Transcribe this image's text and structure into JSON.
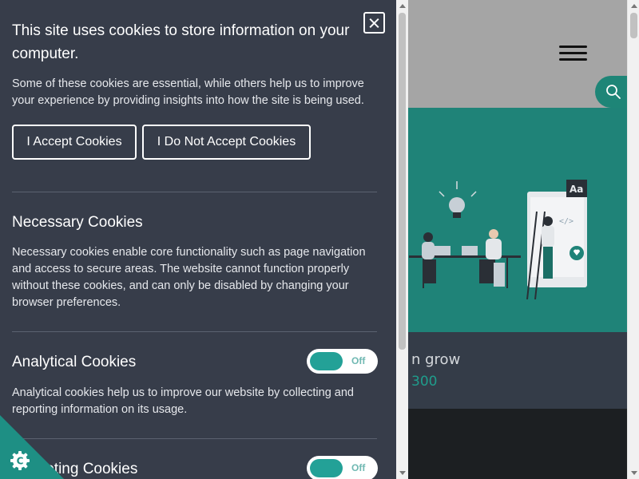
{
  "cookie_panel": {
    "title": "This site uses cookies to store information on your computer.",
    "intro": "Some of these cookies are essential, while others help us to improve your experience by providing insights into how the site is being used.",
    "accept_label": "I Accept Cookies",
    "decline_label": "I Do Not Accept Cookies",
    "close_icon": "close-icon",
    "sections": [
      {
        "title": "Necessary Cookies",
        "text": "Necessary cookies enable core functionality such as page navigation and access to secure areas. The website cannot function properly without these cookies, and can only be disabled by changing your browser preferences."
      },
      {
        "title": "Analytical Cookies",
        "text": "Analytical cookies help us to improve our website by collecting and reporting information on its usage.",
        "toggle_state": "Off"
      },
      {
        "title": "Marketing Cookies",
        "toggle_state": "Off"
      }
    ]
  },
  "background_site": {
    "card_title": "n grow",
    "card_subtitle": "300",
    "icons": [
      "menu-icon",
      "search-icon"
    ],
    "colors": {
      "header": "#a5a5a5",
      "hero": "#1f8378",
      "card": "#343c48",
      "accent": "#1f9d8c"
    }
  },
  "cookie_badge": {
    "icon": "cookie-settings-icon",
    "color": "#1e8f84"
  },
  "colors": {
    "panel_bg": "#373d4a",
    "toggle_knob": "#23a197",
    "text": "#ffffff"
  }
}
